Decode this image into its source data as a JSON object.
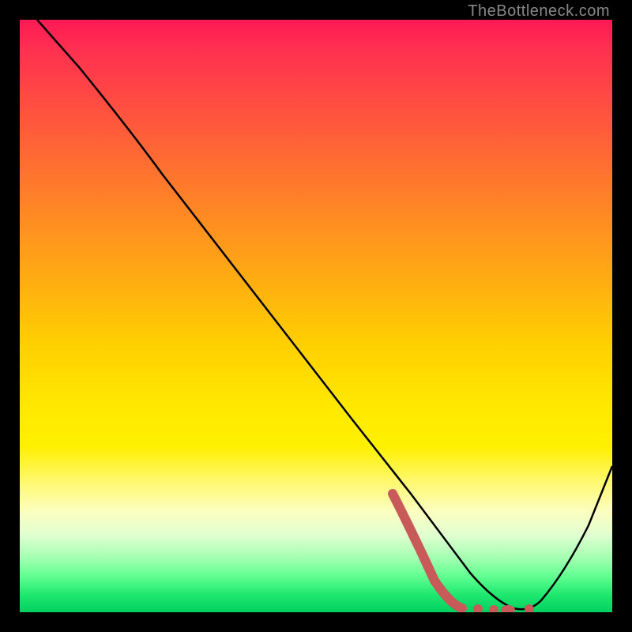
{
  "watermark": "TheBottleneck.com",
  "chart_data": {
    "type": "line",
    "title": "",
    "xlabel": "",
    "ylabel": "",
    "xlim": [
      0,
      100
    ],
    "ylim": [
      0,
      100
    ],
    "series": [
      {
        "name": "black-curve",
        "color": "#000000",
        "x": [
          3,
          10,
          20,
          30,
          40,
          50,
          60,
          66,
          70,
          74,
          78,
          82,
          86,
          90,
          95,
          100
        ],
        "y": [
          100,
          92,
          80,
          65,
          52,
          39,
          26,
          18,
          13,
          8,
          4,
          1,
          0,
          4,
          12,
          25
        ]
      },
      {
        "name": "red-dashed-marker",
        "color": "#cc5555",
        "style": "dashed-thick",
        "x": [
          63,
          68,
          72,
          75,
          78,
          81,
          84
        ],
        "y": [
          20,
          10,
          3,
          1,
          0.5,
          0.5,
          0.5
        ]
      }
    ]
  },
  "colors": {
    "top": "#ff1a55",
    "mid": "#ffe000",
    "bottom": "#00d060",
    "curve": "#000000",
    "marker": "#cc5555",
    "frame": "#000000"
  }
}
